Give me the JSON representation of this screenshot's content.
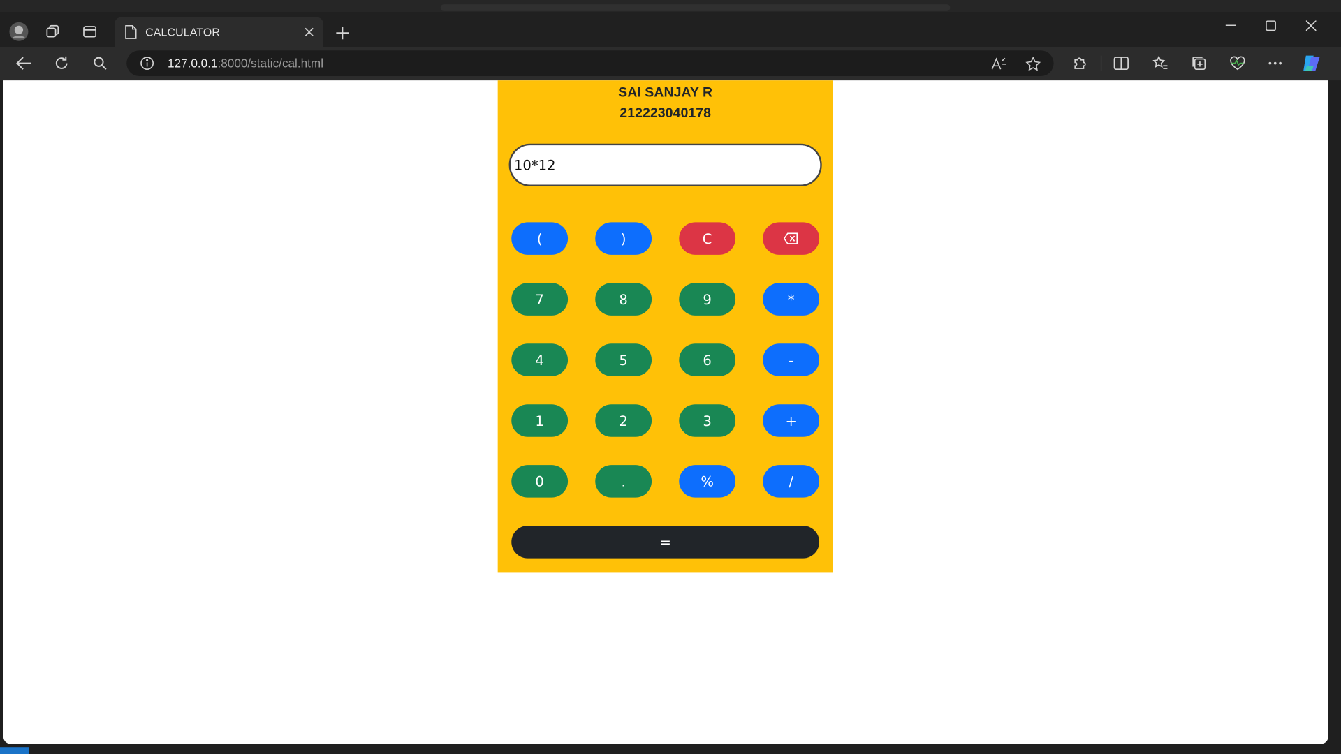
{
  "browser": {
    "tab_title": "CALCULATOR",
    "url_host": "127.0.0.1",
    "url_rest": ":8000/static/cal.html"
  },
  "page": {
    "name": "SAI SANJAY R",
    "roll_number": "212223040178",
    "display_value": "10*12"
  },
  "keypad": {
    "row1": [
      "(",
      ")",
      "C",
      "backspace"
    ],
    "row2": [
      "7",
      "8",
      "9",
      "*"
    ],
    "row3": [
      "4",
      "5",
      "6",
      "-"
    ],
    "row4": [
      "1",
      "2",
      "3",
      "+"
    ],
    "row5": [
      "0",
      ".",
      "%",
      "/"
    ],
    "equals": "="
  },
  "colors": {
    "calculator_bg": "#ffc107",
    "digit_key": "#198754",
    "operator_key": "#0d6efd",
    "clear_key": "#dc3545",
    "equals_key": "#212529"
  }
}
